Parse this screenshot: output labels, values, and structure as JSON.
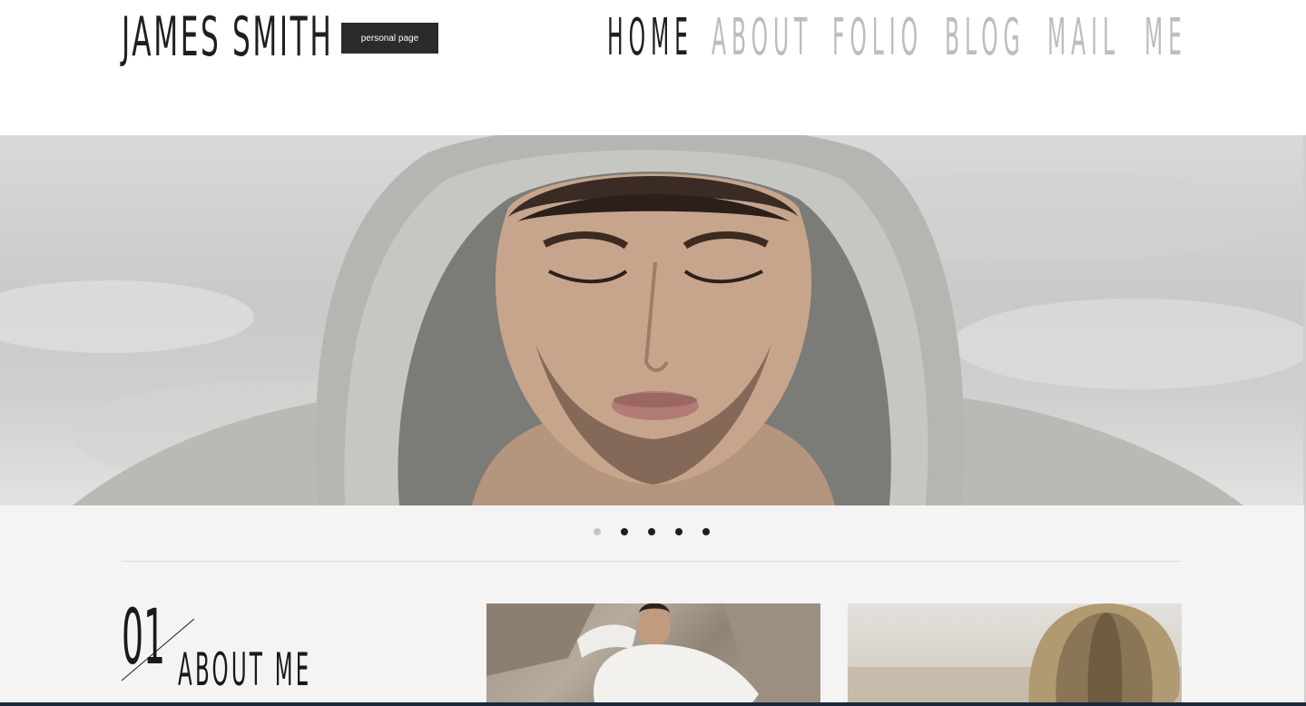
{
  "header": {
    "logo": "JAMES SMITH",
    "badge": "personal page"
  },
  "nav": {
    "items": [
      {
        "label": "HOME",
        "active": true
      },
      {
        "label": "ABOUT",
        "active": false
      },
      {
        "label": "FOLIO",
        "active": false
      },
      {
        "label": "BLOG",
        "active": false
      },
      {
        "label": "MAIL",
        "active": false
      },
      {
        "label": "ME",
        "active": false
      }
    ]
  },
  "slider": {
    "slide_count": 5,
    "active_index": 0
  },
  "about": {
    "number": "01",
    "title": "ABOUT ME"
  },
  "colors": {
    "text_dark": "#1f1f1f",
    "nav_inactive": "#bdbdc0",
    "badge_bg": "#2b2b2b",
    "content_bg": "#f4f4f4"
  }
}
